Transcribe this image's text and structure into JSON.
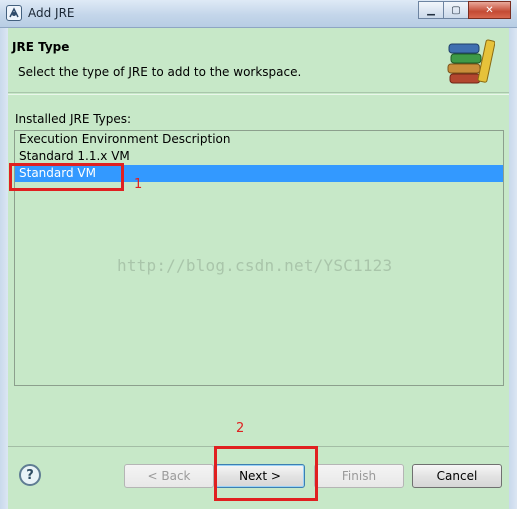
{
  "window": {
    "title": "Add JRE",
    "controls": {
      "minimize": "▁",
      "maximize": "▢",
      "close": "✕"
    }
  },
  "banner": {
    "title": "JRE Type",
    "description": "Select the type of JRE to add to the workspace.",
    "icon": "books-icon"
  },
  "list": {
    "label": "Installed JRE Types:",
    "items": [
      {
        "label": "Execution Environment Description",
        "selected": false
      },
      {
        "label": "Standard 1.1.x VM",
        "selected": false
      },
      {
        "label": "Standard VM",
        "selected": true
      }
    ]
  },
  "watermark": "http://blog.csdn.net/YSC1123",
  "footer": {
    "help_label": "?",
    "back_label": "< Back",
    "next_label": "Next >",
    "finish_label": "Finish",
    "cancel_label": "Cancel"
  },
  "annotations": {
    "step1": "1",
    "step2": "2"
  },
  "colors": {
    "background": "#c7e8c8",
    "selection": "#3399ff",
    "annotation": "#e02020"
  }
}
